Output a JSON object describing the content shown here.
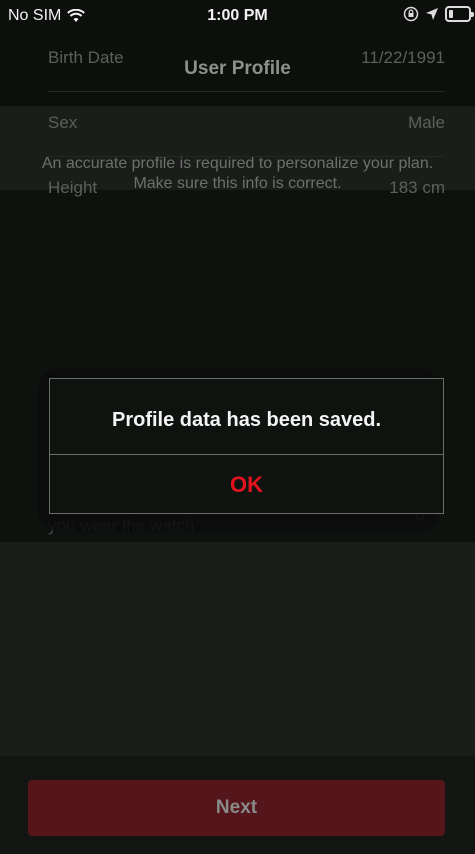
{
  "status_bar": {
    "carrier": "No SIM",
    "time": "1:00 PM"
  },
  "nav": {
    "title": "User Profile"
  },
  "intro": {
    "text": "An accurate profile is required to personalize your plan. Make sure this info is correct."
  },
  "profile_rows": [
    {
      "label": "Birth Date",
      "value": "11/22/1991"
    },
    {
      "label": "Sex",
      "value": "Male"
    },
    {
      "label": "Height",
      "value": "183 cm"
    }
  ],
  "wear": {
    "label": "you wear the watch",
    "value": "0"
  },
  "alert": {
    "message": "Profile data has been saved.",
    "ok_label": "OK"
  },
  "footer": {
    "next_label": "Next"
  },
  "colors": {
    "accent": "#e3121f",
    "next_button": "#54161a",
    "background": "#0e120f"
  }
}
